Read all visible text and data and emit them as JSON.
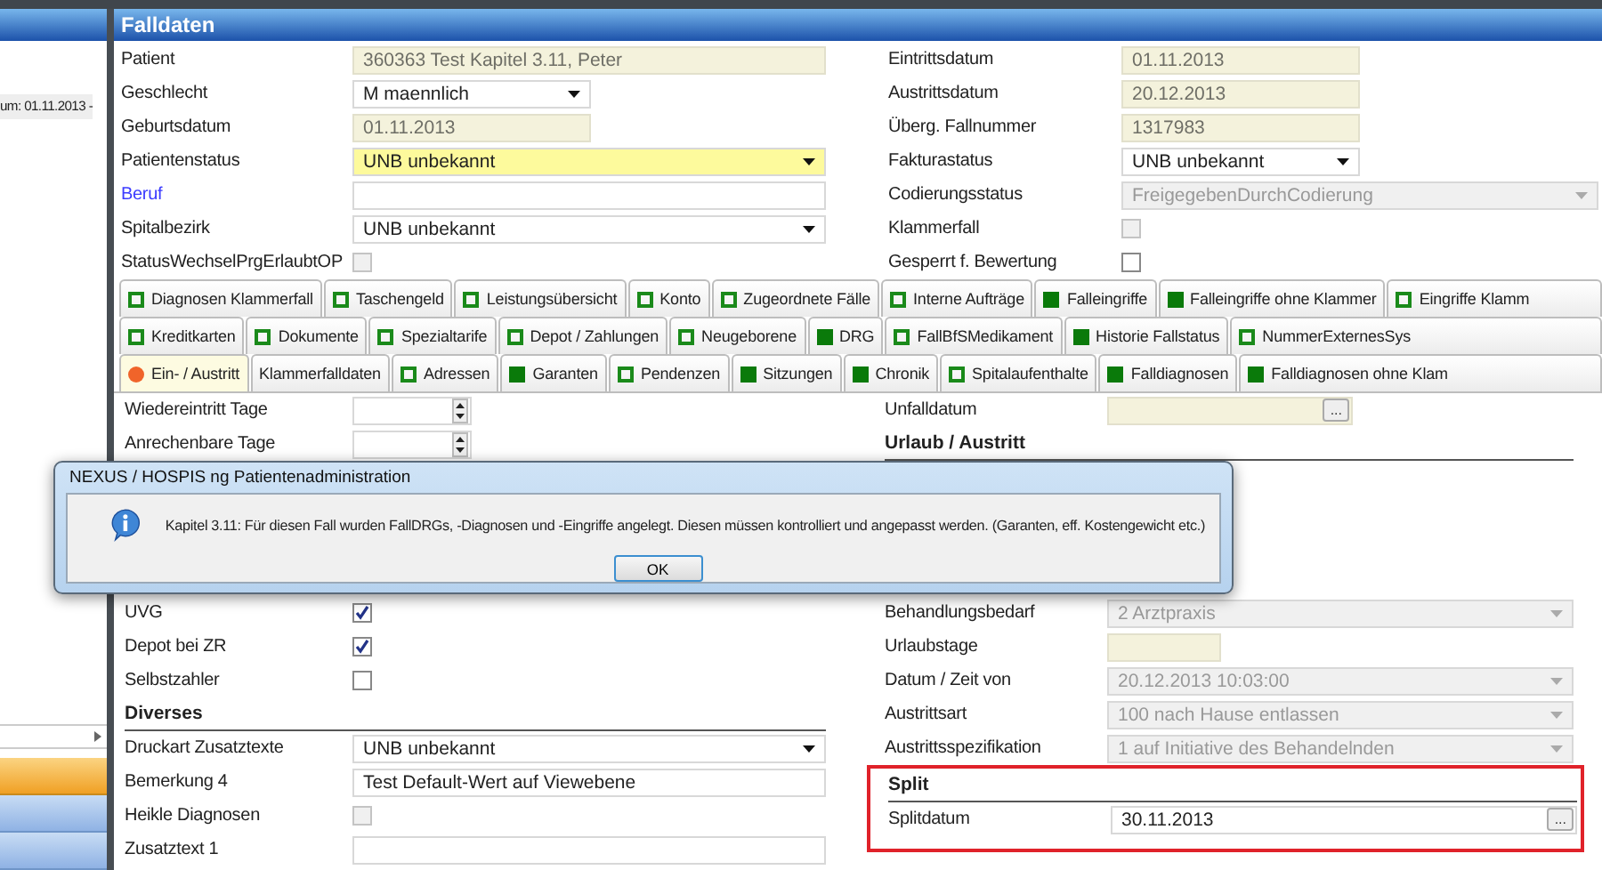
{
  "sidebar": {
    "date_text": "um:  01.11.2013 -",
    "items": [
      {
        "selected": true
      },
      {
        "selected": false
      },
      {
        "selected": false
      }
    ]
  },
  "panel": {
    "title": "Falldaten"
  },
  "fields_left": [
    {
      "label": "Patient",
      "kind": "text",
      "value": "360363 Test Kapitel 3.11,  Peter",
      "disabled": true
    },
    {
      "label": "Geschlecht",
      "kind": "select",
      "value": "M maennlich",
      "disabled": false
    },
    {
      "label": "Geburtsdatum",
      "kind": "text",
      "value": "01.11.2013",
      "disabled": true
    },
    {
      "label": "Patientenstatus",
      "kind": "select",
      "value": "UNB unbekannt",
      "disabled": false,
      "highlighted": true
    },
    {
      "label": "Beruf",
      "kind": "text",
      "disabled": false,
      "link": true
    },
    {
      "label": "Spitalbezirk",
      "kind": "select",
      "value": "UNB unbekannt",
      "disabled": false
    },
    {
      "label": "StatusWechselPrgErlaubtOP",
      "kind": "checkbox",
      "checked": false,
      "disabled": true
    }
  ],
  "fields_right": [
    {
      "label": "Eintrittsdatum",
      "kind": "text",
      "value": "01.11.2013",
      "disabled": true
    },
    {
      "label": "Austrittsdatum",
      "kind": "text",
      "value": "20.12.2013",
      "disabled": true
    },
    {
      "label": "Überg. Fallnummer",
      "kind": "text",
      "value": "1317983",
      "disabled": true
    },
    {
      "label": "Fakturastatus",
      "kind": "select",
      "value": "UNB unbekannt",
      "disabled": false
    },
    {
      "label": "Codierungsstatus",
      "kind": "select",
      "value": "FreigegebenDurchCodierung",
      "disabled": true
    },
    {
      "label": "Klammerfall",
      "kind": "checkbox",
      "checked": false,
      "disabled": true
    },
    {
      "label": "Gesperrt f. Bewertung",
      "kind": "checkbox",
      "checked": false,
      "disabled": false
    }
  ],
  "tab_rows": [
    {
      "tabs": [
        {
          "label": "Diagnosen Klammerfall",
          "kind": "outline",
          "selected": false
        },
        {
          "label": "Taschengeld",
          "kind": "outline",
          "selected": false
        },
        {
          "label": "Leistungsübersicht",
          "kind": "outline",
          "selected": false
        },
        {
          "label": "Konto",
          "kind": "outline",
          "selected": false
        },
        {
          "label": "Zugeordnete Fälle",
          "kind": "outline",
          "selected": false
        },
        {
          "label": "Interne Aufträge",
          "kind": "outline",
          "selected": false
        },
        {
          "label": "Falleingriffe",
          "kind": "filled",
          "selected": false
        },
        {
          "label": "Falleingriffe ohne Klammer",
          "kind": "filled",
          "selected": false
        },
        {
          "label": "Eingriffe Klamm",
          "kind": "outline",
          "selected": false
        }
      ]
    },
    {
      "tabs": [
        {
          "label": "Kreditkarten",
          "kind": "outline",
          "selected": false
        },
        {
          "label": "Dokumente",
          "kind": "outline",
          "selected": false
        },
        {
          "label": "Spezialtarife",
          "kind": "outline",
          "selected": false
        },
        {
          "label": "Depot / Zahlungen",
          "kind": "outline",
          "selected": false
        },
        {
          "label": "Neugeborene",
          "kind": "outline",
          "selected": false
        },
        {
          "label": "DRG",
          "kind": "filled",
          "selected": false
        },
        {
          "label": "FallBfSMedikament",
          "kind": "outline",
          "selected": false
        },
        {
          "label": "Historie Fallstatus",
          "kind": "filled",
          "selected": false
        },
        {
          "label": "NummerExternesSys",
          "kind": "outline",
          "selected": false
        }
      ]
    },
    {
      "tabs": [
        {
          "label": "Ein- / Austritt",
          "kind": "dot",
          "selected": true
        },
        {
          "label": "Klammerfalldaten",
          "kind": "plain",
          "selected": false
        },
        {
          "label": "Adressen",
          "kind": "outline",
          "selected": false
        },
        {
          "label": "Garanten",
          "kind": "filled",
          "selected": false
        },
        {
          "label": "Pendenzen",
          "kind": "outline",
          "selected": false
        },
        {
          "label": "Sitzungen",
          "kind": "filled",
          "selected": false
        },
        {
          "label": "Chronik",
          "kind": "filled",
          "selected": false
        },
        {
          "label": "Spitalaufenthalte",
          "kind": "outline",
          "selected": false
        },
        {
          "label": "Falldiagnosen",
          "kind": "filled",
          "selected": false
        },
        {
          "label": "Falldiagnosen ohne Klam",
          "kind": "filled",
          "selected": false
        }
      ]
    }
  ],
  "detail": {
    "left_upper": [
      {
        "label": "Wiedereintritt Tage",
        "kind": "spinner",
        "disabled": false
      },
      {
        "label": "Anrechenbare Tage",
        "kind": "spinner",
        "disabled": false
      }
    ],
    "left_lower": [
      {
        "label": "UVG",
        "kind": "checkbox",
        "checked": true,
        "disabled": false
      },
      {
        "label": "Depot bei ZR",
        "kind": "checkbox",
        "checked": true,
        "disabled": false
      },
      {
        "label": "Selbstzahler",
        "kind": "checkbox",
        "checked": false,
        "disabled": false
      },
      {
        "label": "Diverses",
        "kind": "header"
      },
      {
        "label": "Druckart Zusatztexte",
        "kind": "select",
        "value": "UNB unbekannt",
        "disabled": false
      },
      {
        "label": "Bemerkung 4",
        "kind": "text",
        "value": "Test Default-Wert auf Viewebene",
        "disabled": false
      },
      {
        "label": "Heikle Diagnosen",
        "kind": "checkbox",
        "checked": false,
        "disabled": true
      },
      {
        "label": "Zusatztext 1",
        "kind": "text",
        "disabled": false
      }
    ],
    "right_upper": [
      {
        "label": "Unfalldatum",
        "kind": "date",
        "button": "...",
        "disabled": true
      },
      {
        "label": "Urlaub / Austritt",
        "kind": "header"
      }
    ],
    "right_lower": [
      {
        "label": "Behandlungsbedarf",
        "kind": "select",
        "value": "2 Arztpraxis",
        "disabled": true
      },
      {
        "label": "Urlaubstage",
        "kind": "text",
        "disabled": true
      },
      {
        "label": "Datum / Zeit von",
        "kind": "select",
        "value": "20.12.2013 10:03:00",
        "disabled": true
      },
      {
        "label": "Austrittsart",
        "kind": "select",
        "value": "100 nach Hause entlassen",
        "disabled": true
      },
      {
        "label": "Austrittsspezifikation",
        "kind": "select",
        "value": "1 auf Initiative des Behandelnden",
        "disabled": true
      }
    ],
    "split": {
      "marked": true,
      "fields": [
        {
          "label": "Split",
          "kind": "header"
        },
        {
          "label": "Splitdatum",
          "kind": "date",
          "value": "30.11.2013",
          "button": "...",
          "disabled": false
        }
      ]
    }
  },
  "dialog": {
    "title": "NEXUS / HOSPIS ng Patientenadministration",
    "message": "Kapitel 3.11: Für diesen Fall wurden FallDRGs, -Diagnosen und -Eingriffe angelegt. Diesen müssen kontrolliert und angepasst werden. (Garanten, eff. Kostengewicht etc.)",
    "buttons": [
      "OK"
    ]
  }
}
